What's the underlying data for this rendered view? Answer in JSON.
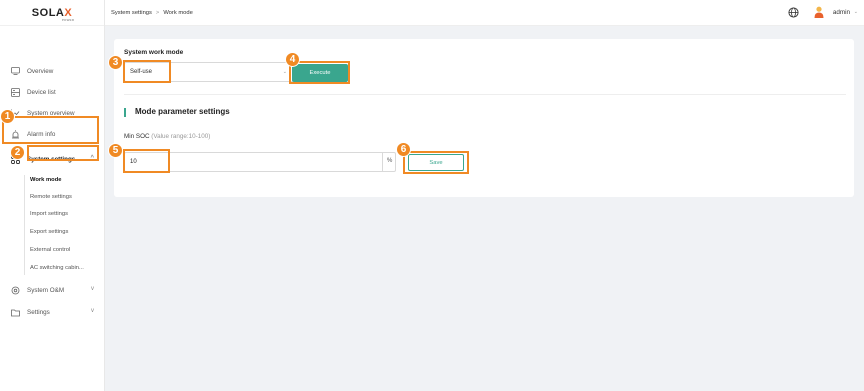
{
  "logo": {
    "main": "SOLA",
    "x": "X",
    "sub": "POWER"
  },
  "sidebar": {
    "items": [
      {
        "label": "Overview",
        "icon": "monitor-icon"
      },
      {
        "label": "Device list",
        "icon": "device-list-icon"
      },
      {
        "label": "System overview",
        "icon": "chart-line-icon"
      },
      {
        "label": "Alarm info",
        "icon": "alarm-icon"
      },
      {
        "label": "System settings",
        "icon": "settings-grid-icon"
      },
      {
        "label": "System O&M",
        "icon": "maintenance-icon"
      },
      {
        "label": "Settings",
        "icon": "folder-icon"
      }
    ],
    "sub_items": [
      "Work mode",
      "Remote settings",
      "Import settings",
      "Export settings",
      "External control",
      "AC switching cabin..."
    ]
  },
  "breadcrumb": {
    "parent": "System settings",
    "separator": ">",
    "current": "Work mode"
  },
  "header": {
    "user": "admin"
  },
  "form": {
    "work_mode_label": "System work mode",
    "work_mode_value": "Self-use",
    "execute_label": "Execute",
    "section_title": "Mode parameter settings",
    "min_soc_label": "Min SOC",
    "min_soc_hint": "(Value range:10-100)",
    "min_soc_value": "10",
    "unit": "%",
    "save_label": "Save"
  },
  "callouts": [
    "1",
    "2",
    "3",
    "4",
    "5",
    "6"
  ],
  "colors": {
    "accent": "#3aa68e",
    "highlight": "#f08a24",
    "brand_x": "#e8612c"
  }
}
